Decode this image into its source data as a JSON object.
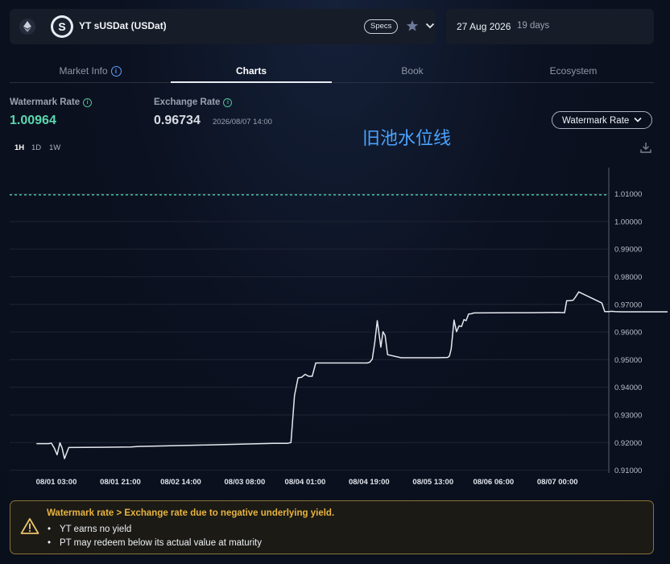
{
  "header": {
    "asset_name": "YT sUSDat (USDat)",
    "specs_label": "Specs",
    "token_glyph": "S",
    "icons": [
      "ethereum-icon",
      "star-icon",
      "chevron-down-icon"
    ]
  },
  "maturity": {
    "date": "27 Aug 2026",
    "days_left": "19 days"
  },
  "tabs": [
    {
      "label": "Market Info",
      "active": false,
      "has_info": true
    },
    {
      "label": "Charts",
      "active": true,
      "has_info": false
    },
    {
      "label": "Book",
      "active": false,
      "has_info": false
    },
    {
      "label": "Ecosystem",
      "active": false,
      "has_info": false
    }
  ],
  "stats": {
    "watermark_label": "Watermark Rate",
    "watermark_value": "1.00964",
    "exchange_label": "Exchange Rate",
    "exchange_value": "0.96734",
    "exchange_time": "2026/08/07 14:00"
  },
  "overlay_annotation": "旧池水位线",
  "dropdown": {
    "selected": "Watermark Rate"
  },
  "timeframes": [
    {
      "label": "1H",
      "active": true
    },
    {
      "label": "1D",
      "active": false
    },
    {
      "label": "1W",
      "active": false
    }
  ],
  "colors": {
    "accent_green": "#5ad7ae",
    "warning": "#e8b43f",
    "overlay_blue": "#4aa3ff",
    "line": "#e6e8ee",
    "watermark_line": "#4fd1b0"
  },
  "chart_data": {
    "type": "line",
    "x_ticks": [
      "08/01 03:00",
      "08/01 21:00",
      "08/02 14:00",
      "08/03 08:00",
      "08/04 01:00",
      "08/04 19:00",
      "08/05 13:00",
      "08/06 06:00",
      "08/07 00:00"
    ],
    "y_ticks": [
      "0.91000",
      "0.92000",
      "0.93000",
      "0.94000",
      "0.95000",
      "0.96000",
      "0.97000",
      "0.98000",
      "0.99000",
      "1.00000",
      "1.01000"
    ],
    "ylim": [
      0.909,
      1.0195
    ],
    "watermark": 1.00964,
    "series": [
      {
        "x_hours": [
          -2.6,
          0.8,
          1.6,
          2.4,
          3.2,
          4.0,
          4.6,
          5.3,
          6.5,
          24,
          26,
          44,
          64,
          68,
          69,
          70,
          71,
          72,
          73,
          74,
          75,
          76,
          90,
          90.5,
          91.2,
          91.9,
          92.6,
          93.3,
          94.3,
          94.9,
          95.5,
          96.2,
          100,
          110,
          113.1,
          113.6,
          114.1,
          114.9,
          115.6,
          116.3,
          117.0,
          117.7,
          118.3,
          119.0,
          119.8,
          120.5,
          133,
          136,
          144,
          146,
          146.6,
          147.2,
          148.4,
          149.0,
          150.0,
          156.5,
          157.3,
          158.5,
          159.3,
          160.2,
          162.0,
          162.8,
          163.6,
          175
        ],
        "y": [
          0.9196,
          0.9196,
          0.9198,
          0.918,
          0.9156,
          0.9199,
          0.918,
          0.9142,
          0.9182,
          0.9184,
          0.9186,
          0.9191,
          0.9197,
          0.9197,
          0.92,
          0.937,
          0.9434,
          0.9436,
          0.9447,
          0.944,
          0.944,
          0.9488,
          0.9488,
          0.9488,
          0.9491,
          0.9502,
          0.9563,
          0.9641,
          0.9545,
          0.9601,
          0.9588,
          0.9518,
          0.9507,
          0.9507,
          0.9508,
          0.9513,
          0.9539,
          0.9643,
          0.9601,
          0.9622,
          0.962,
          0.9645,
          0.9641,
          0.9665,
          0.9666,
          0.9669,
          0.967,
          0.967,
          0.9671,
          0.967,
          0.9713,
          0.9713,
          0.9715,
          0.9725,
          0.9745,
          0.9705,
          0.9674,
          0.9674,
          0.9675,
          0.9674,
          0.9673,
          0.9673,
          0.9673,
          0.9673
        ]
      }
    ],
    "grid": "horizontal",
    "legend": "none"
  },
  "warning": {
    "title": "Watermark rate > Exchange rate due to negative underlying yield.",
    "items": [
      "YT earns no yield",
      "PT may redeem below its actual value at maturity"
    ]
  }
}
